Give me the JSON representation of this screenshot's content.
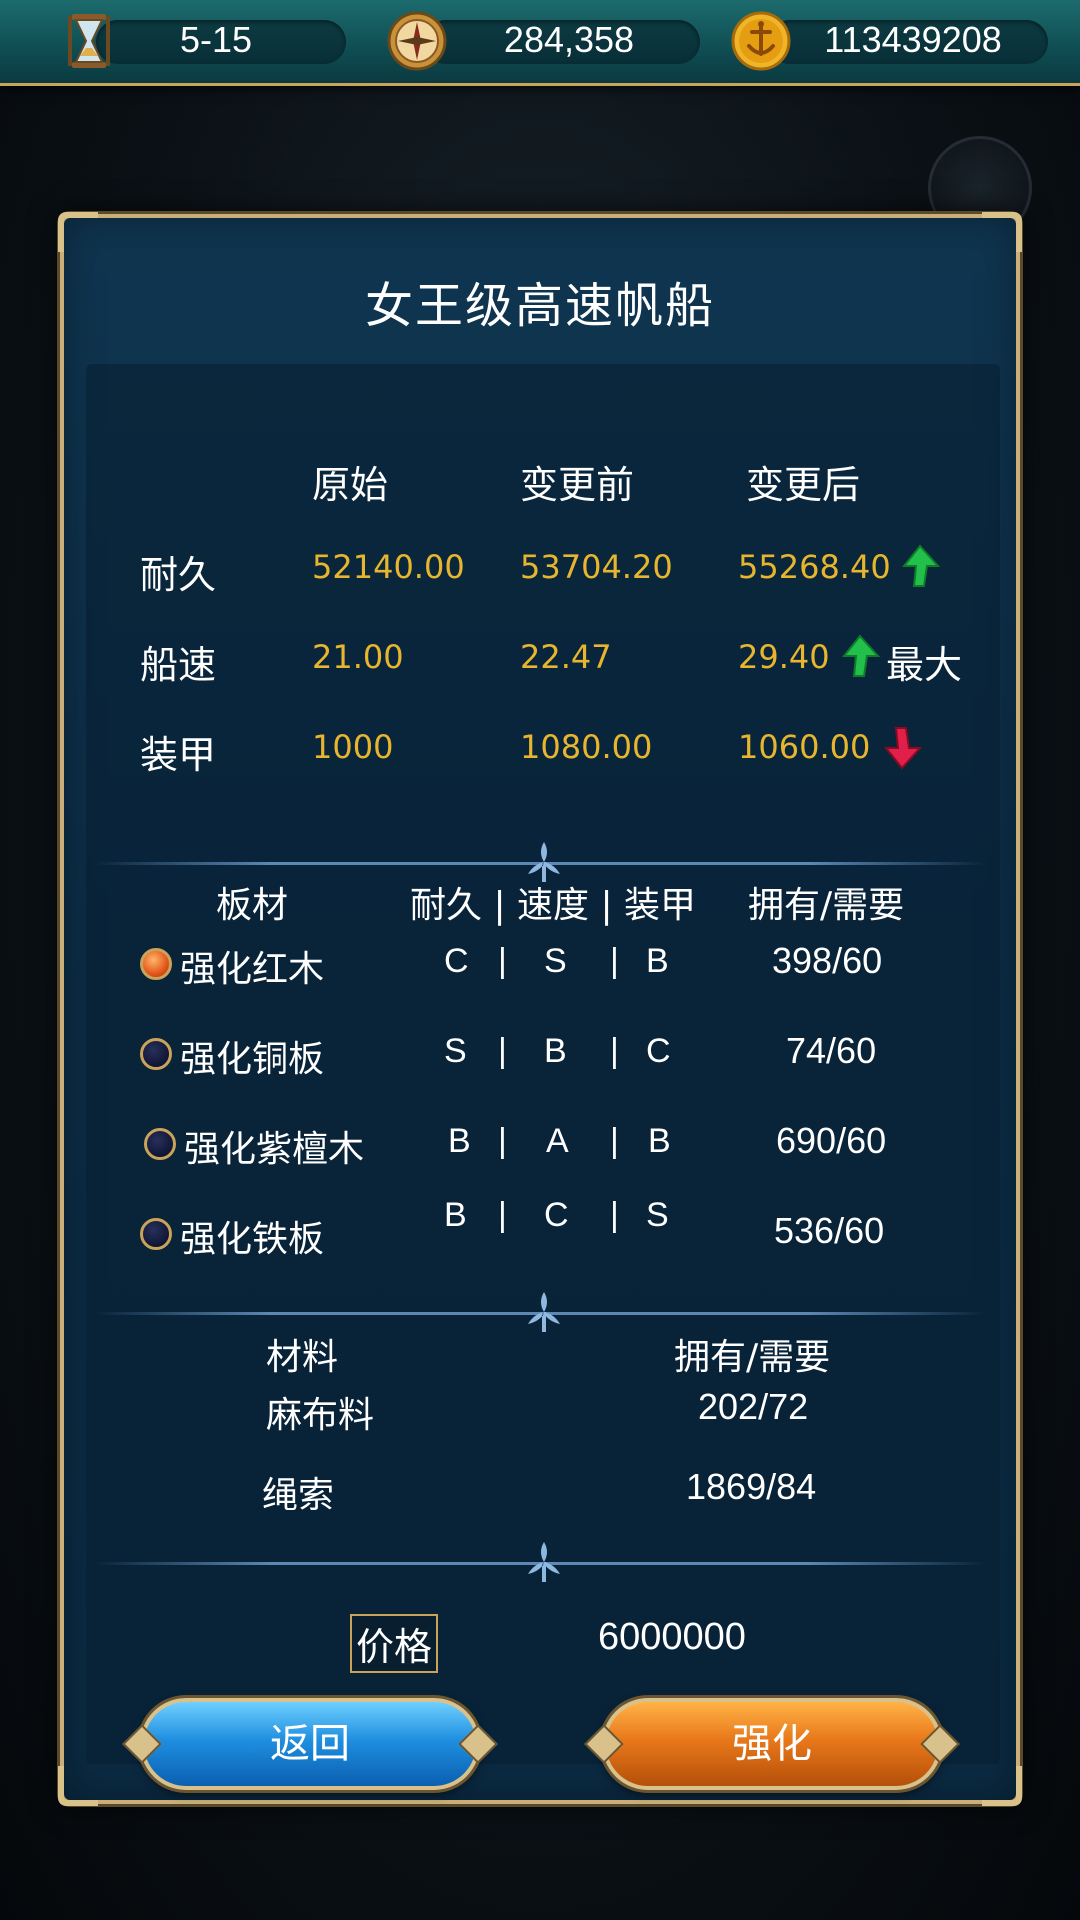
{
  "topbar": {
    "date": "5-15",
    "compass_value": "284,358",
    "gold_value": "113439208",
    "icons": [
      "hourglass-icon",
      "compass-icon",
      "anchor-coin-icon"
    ]
  },
  "dialog": {
    "title": "女王级高速帆船",
    "stats": {
      "headers": [
        "原始",
        "变更前",
        "变更后"
      ],
      "rows": [
        {
          "label": "耐久",
          "original": "52140.00",
          "before": "53704.20",
          "after": "55268.40",
          "trend": "up",
          "note": ""
        },
        {
          "label": "船速",
          "original": "21.00",
          "before": "22.47",
          "after": "29.40",
          "trend": "up",
          "note": "最大"
        },
        {
          "label": "装甲",
          "original": "1000",
          "before": "1080.00",
          "after": "1060.00",
          "trend": "down",
          "note": ""
        }
      ]
    },
    "boards": {
      "header_name": "板材",
      "header_grades": "耐久 | 速度 | 装甲",
      "header_own": "拥有/需要",
      "items": [
        {
          "name": "强化红木",
          "dur": "C",
          "spd": "S",
          "arm": "B",
          "own": "398/60",
          "selected": true
        },
        {
          "name": "强化铜板",
          "dur": "S",
          "spd": "B",
          "arm": "C",
          "own": "74/60",
          "selected": false
        },
        {
          "name": "强化紫檀木",
          "dur": "B",
          "spd": "A",
          "arm": "B",
          "own": "690/60",
          "selected": false
        },
        {
          "name": "强化铁板",
          "dur": "B",
          "spd": "C",
          "arm": "S",
          "own": "536/60",
          "selected": false
        }
      ]
    },
    "materials": {
      "header_name": "材料",
      "header_own": "拥有/需要",
      "items": [
        {
          "name": "麻布料",
          "own": "202/72"
        },
        {
          "name": "绳索",
          "own": "1869/84"
        }
      ]
    },
    "price": {
      "label": "价格",
      "value": "6000000"
    },
    "buttons": {
      "back": "返回",
      "enhance": "强化"
    }
  },
  "colors": {
    "number_gold": "#e7b52e",
    "trend_up": "#22c04a",
    "trend_down": "#e0204a",
    "frame_gold": "#c9b07a"
  }
}
